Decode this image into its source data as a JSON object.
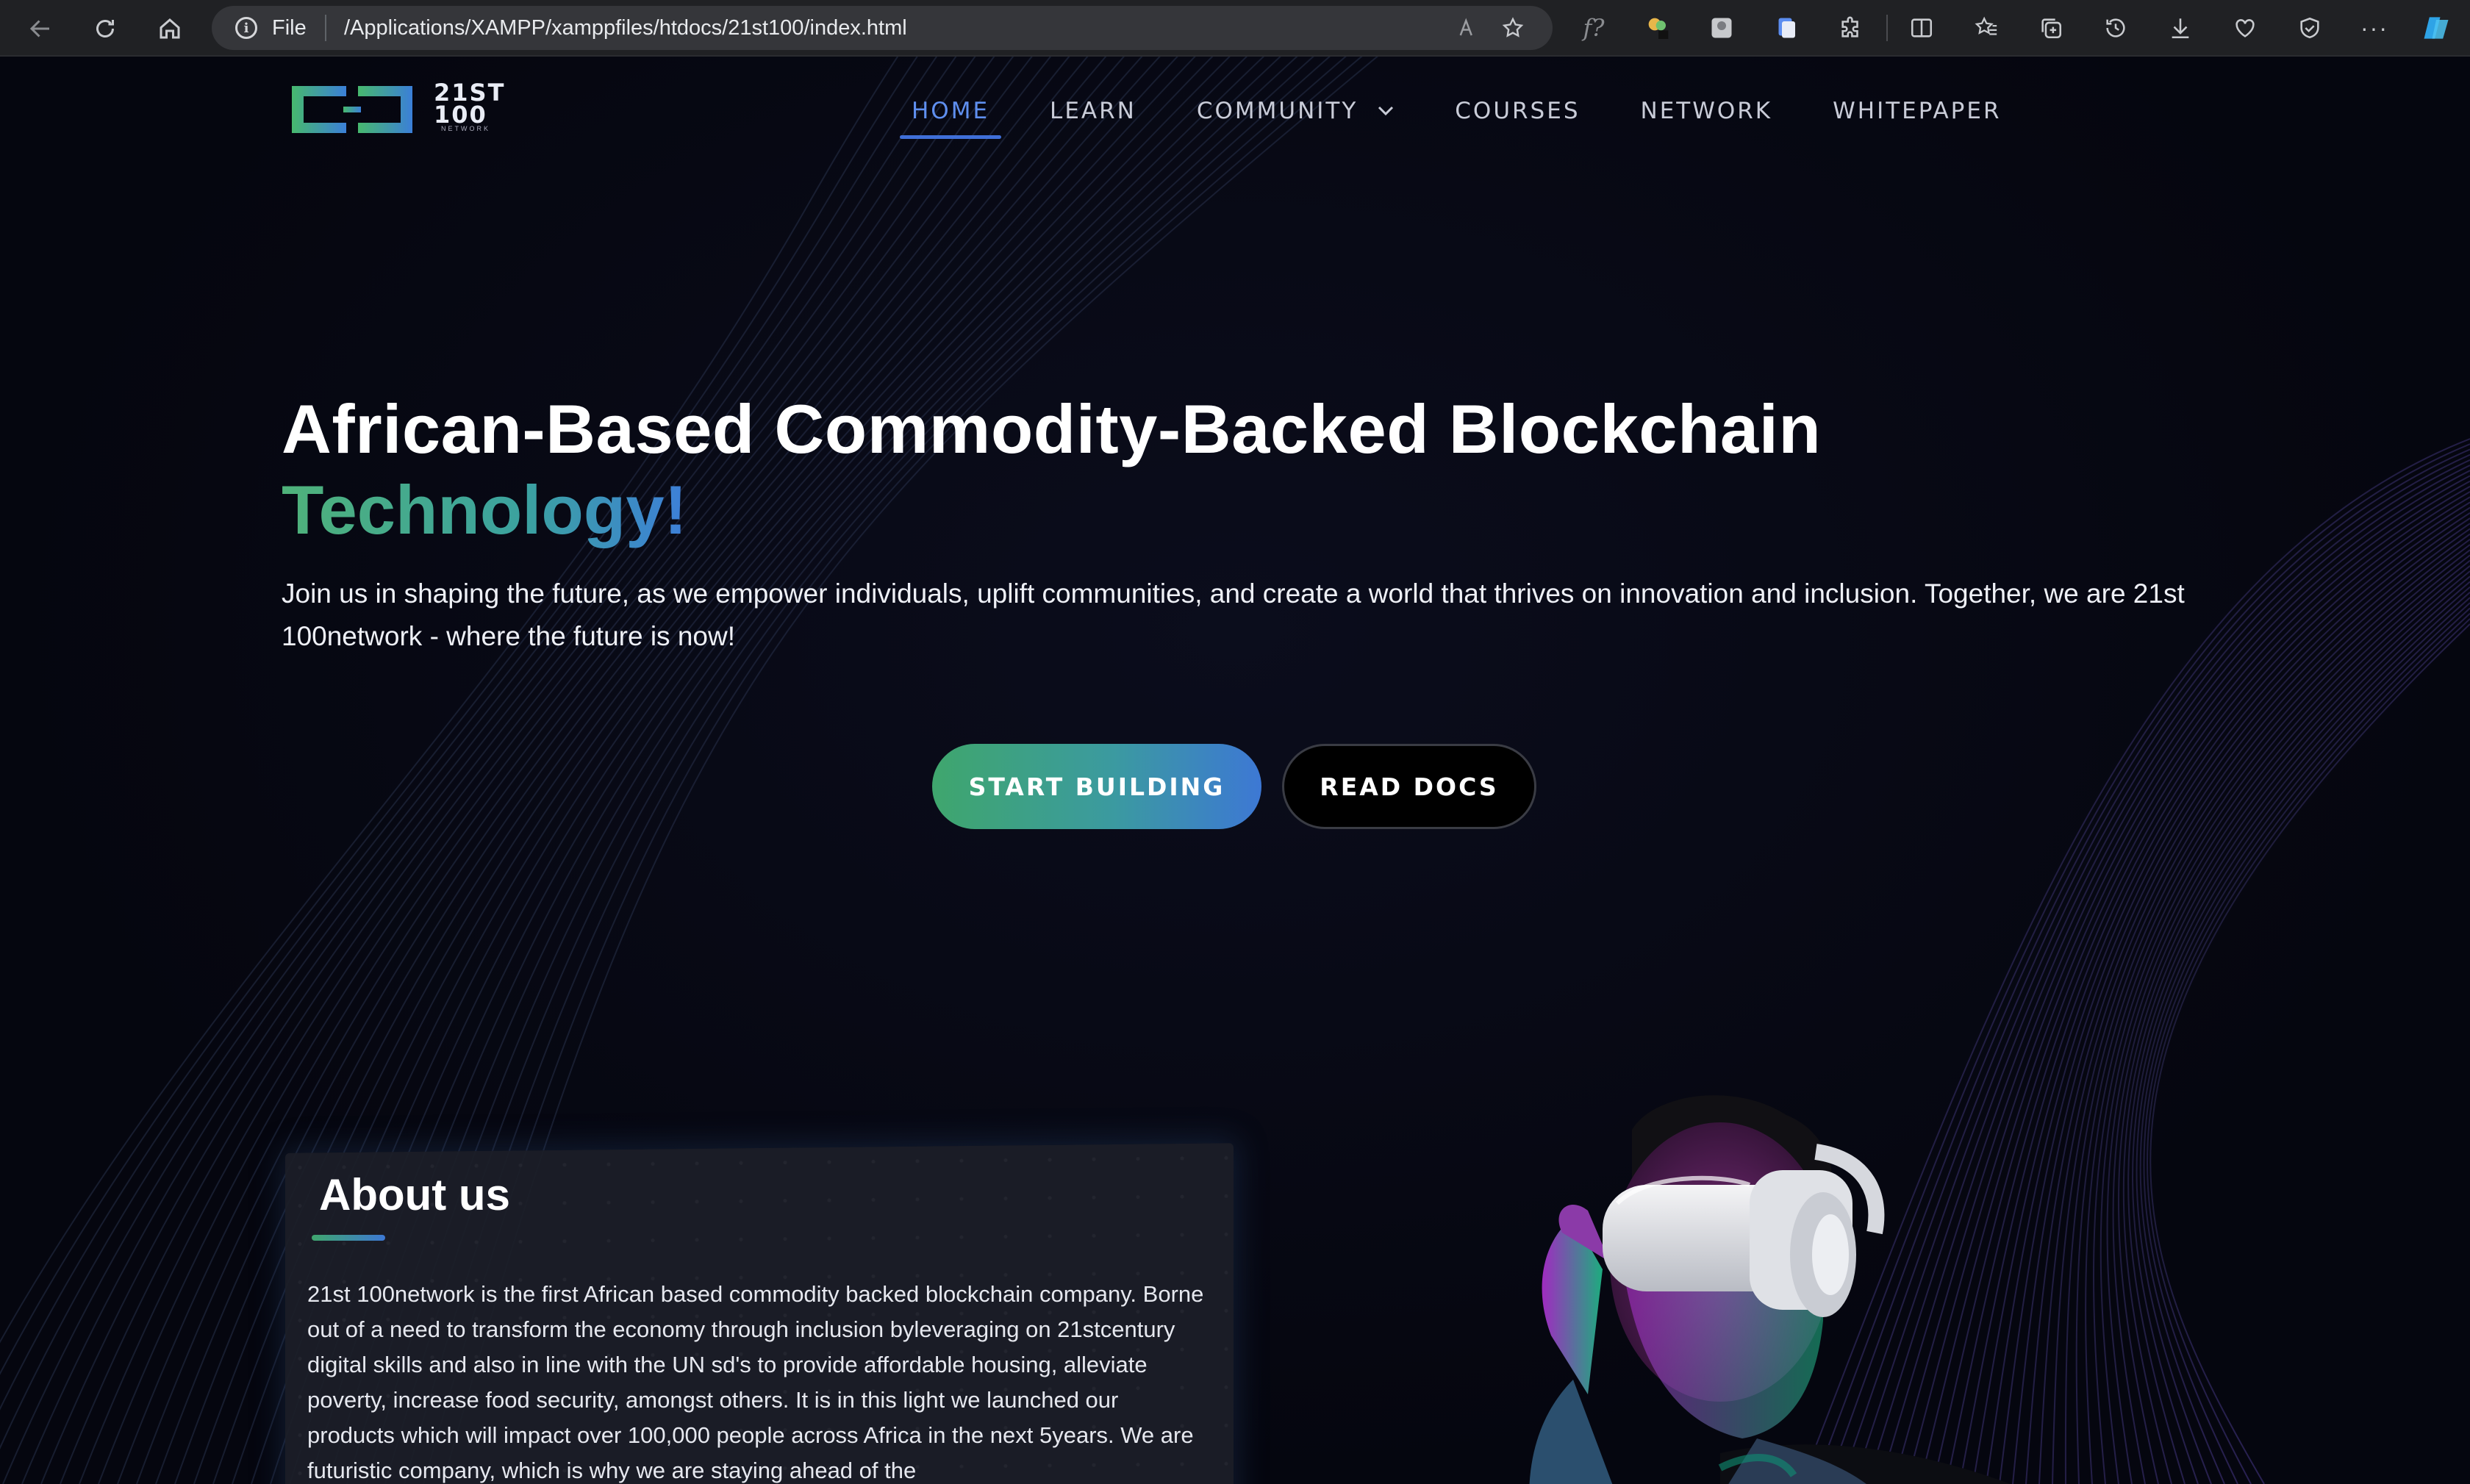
{
  "browser": {
    "file_label": "File",
    "url": "/Applications/XAMPP/xamppfiles/htdocs/21st100/index.html"
  },
  "site": {
    "logo_text_line1": "21ST",
    "logo_text_line2": "100",
    "logo_sub": "NETWORK",
    "nav": [
      {
        "label": "HOME",
        "active": true
      },
      {
        "label": "LEARN"
      },
      {
        "label": "COMMUNITY"
      },
      {
        "label": "COURSES"
      },
      {
        "label": "NETWORK"
      },
      {
        "label": "WHITEPAPER"
      }
    ]
  },
  "hero": {
    "title": "African-Based Commodity-Backed Blockchain",
    "title_highlight": "Technology!",
    "description": "Join us in shaping the future, as we empower individuals, uplift communities, and create a world that thrives on innovation and inclusion. Together, we are 21st 100network - where the future is now!",
    "cta_primary": "START BUILDING",
    "cta_secondary": "READ DOCS"
  },
  "about": {
    "title": "About us",
    "text": "21st 100network is the first African based commodity backed blockchain company. Borne out of a need to transform the economy through inclusion byleveraging on 21stcentury digital skills and also in line with the UN sd's to provide affordable housing, alleviate poverty, increase food security, amongst others. It is in this light we launched our products which will impact over 100,000 people across Africa in the next 5years. We are futuristic company, which is why we are staying ahead of the"
  },
  "colors": {
    "accent_blue": "#3d78d4",
    "accent_green": "#3fa66d",
    "page_bg": "#05060f"
  }
}
